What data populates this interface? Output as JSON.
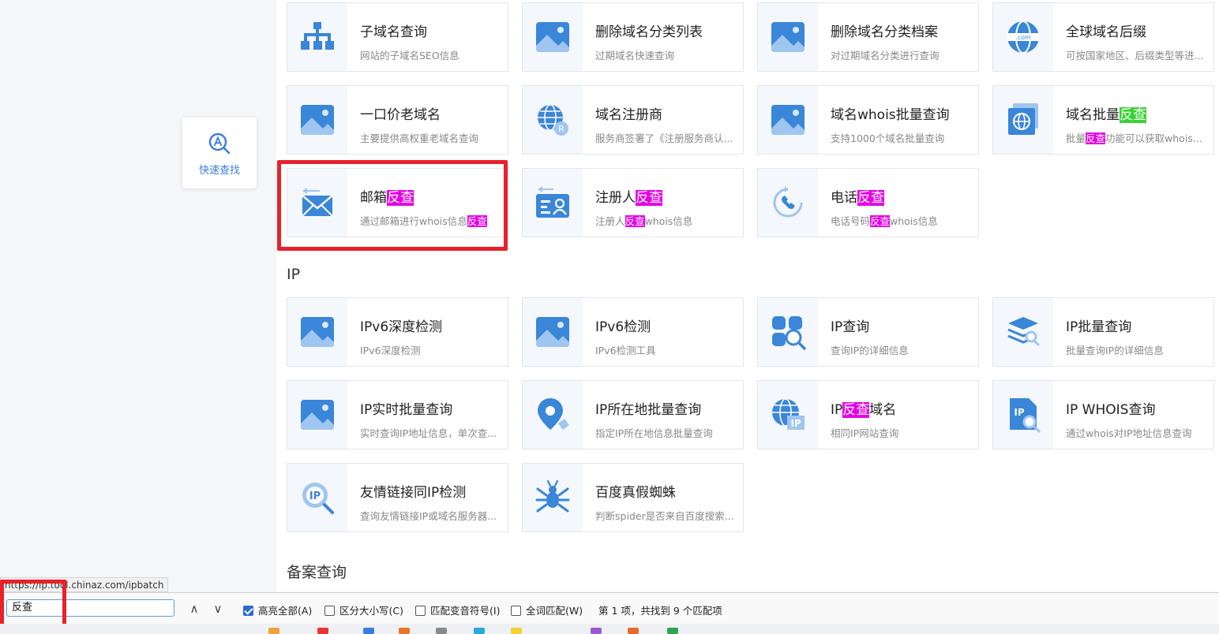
{
  "quick_find": {
    "label": "快速查找"
  },
  "cards": [
    {
      "title": [
        {
          "t": "子域名查询"
        }
      ],
      "desc": [
        {
          "t": "网站的子域名SEO信息"
        }
      ]
    },
    {
      "title": [
        {
          "t": "删除域名分类列表"
        }
      ],
      "desc": [
        {
          "t": "过期域名快速查询"
        }
      ]
    },
    {
      "title": [
        {
          "t": "删除域名分类档案"
        }
      ],
      "desc": [
        {
          "t": "对过期域名分类进行查询"
        }
      ]
    },
    {
      "title": [
        {
          "t": "全球域名后缀"
        }
      ],
      "desc": [
        {
          "t": "可按国家地区、后缀类型等进..."
        }
      ]
    },
    {
      "title": [
        {
          "t": "一口价老域名"
        }
      ],
      "desc": [
        {
          "t": "主要提供高权重老域名查询"
        }
      ]
    },
    {
      "title": [
        {
          "t": "域名注册商"
        }
      ],
      "desc": [
        {
          "t": "服务商签署了《注册服务商认..."
        }
      ]
    },
    {
      "title": [
        {
          "t": "域名whois批量查询"
        }
      ],
      "desc": [
        {
          "t": "支持1000个域名批量查询"
        }
      ]
    },
    {
      "title": [
        {
          "t": "域名批量"
        },
        {
          "t": "反查",
          "h": "g"
        }
      ],
      "desc": [
        {
          "t": "批量"
        },
        {
          "t": "反查",
          "h": "m"
        },
        {
          "t": "功能可以获取whois..."
        }
      ]
    },
    {
      "title": [
        {
          "t": "邮箱"
        },
        {
          "t": "反查",
          "h": "m"
        }
      ],
      "desc": [
        {
          "t": "通过邮箱进行whois信息"
        },
        {
          "t": "反查",
          "h": "m"
        }
      ]
    },
    {
      "title": [
        {
          "t": "注册人"
        },
        {
          "t": "反查",
          "h": "m"
        }
      ],
      "desc": [
        {
          "t": "注册人"
        },
        {
          "t": "反查",
          "h": "m"
        },
        {
          "t": "whois信息"
        }
      ]
    },
    {
      "title": [
        {
          "t": "电话"
        },
        {
          "t": "反查",
          "h": "m"
        }
      ],
      "desc": [
        {
          "t": "电话号码"
        },
        {
          "t": "反查",
          "h": "m"
        },
        {
          "t": "whois信息"
        }
      ]
    },
    {
      "title": [
        {
          "t": "IPv6深度检测"
        }
      ],
      "desc": [
        {
          "t": "IPv6深度检测"
        }
      ]
    },
    {
      "title": [
        {
          "t": "IPv6检测"
        }
      ],
      "desc": [
        {
          "t": "IPv6检测工具"
        }
      ]
    },
    {
      "title": [
        {
          "t": "IP查询"
        }
      ],
      "desc": [
        {
          "t": "查询IP的详细信息"
        }
      ]
    },
    {
      "title": [
        {
          "t": "IP批量查询"
        }
      ],
      "desc": [
        {
          "t": "批量查询IP的详细信息"
        }
      ]
    },
    {
      "title": [
        {
          "t": "IP实时批量查询"
        }
      ],
      "desc": [
        {
          "t": "实时查询IP地址信息，单次查..."
        }
      ]
    },
    {
      "title": [
        {
          "t": "IP所在地批量查询"
        }
      ],
      "desc": [
        {
          "t": "指定IP所在地信息批量查询"
        }
      ]
    },
    {
      "title": [
        {
          "t": "IP"
        },
        {
          "t": "反查",
          "h": "m"
        },
        {
          "t": "域名"
        }
      ],
      "desc": [
        {
          "t": "相同IP网站查询"
        }
      ]
    },
    {
      "title": [
        {
          "t": "IP WHOIS查询"
        }
      ],
      "desc": [
        {
          "t": "通过whois对IP地址信息查询"
        }
      ]
    },
    {
      "title": [
        {
          "t": "友情链接同IP检测"
        }
      ],
      "desc": [
        {
          "t": "查询友情链接IP或域名服务器..."
        }
      ]
    },
    {
      "title": [
        {
          "t": "百度真假蜘蛛"
        }
      ],
      "desc": [
        {
          "t": "判断spider是否来自百度搜索..."
        }
      ]
    }
  ],
  "sections": {
    "ip": "IP",
    "beian": "备案查询"
  },
  "status_url": "https://ip.tool.chinaz.com/ipbatch",
  "findbar": {
    "query": "反查",
    "prev": "∧",
    "next": "∨",
    "highlight_all": "高亮全部(A)",
    "match_case": "区分大小写(C)",
    "match_diacritics": "匹配变音符号(I)",
    "whole_words": "全词匹配(W)",
    "status": "第 1 项，共找到 9 个匹配项"
  },
  "colors": {
    "accent": "#3a7ddc",
    "highlight_current": "#38d430",
    "highlight_other": "#e600e6",
    "annotation": "#e8212b"
  }
}
